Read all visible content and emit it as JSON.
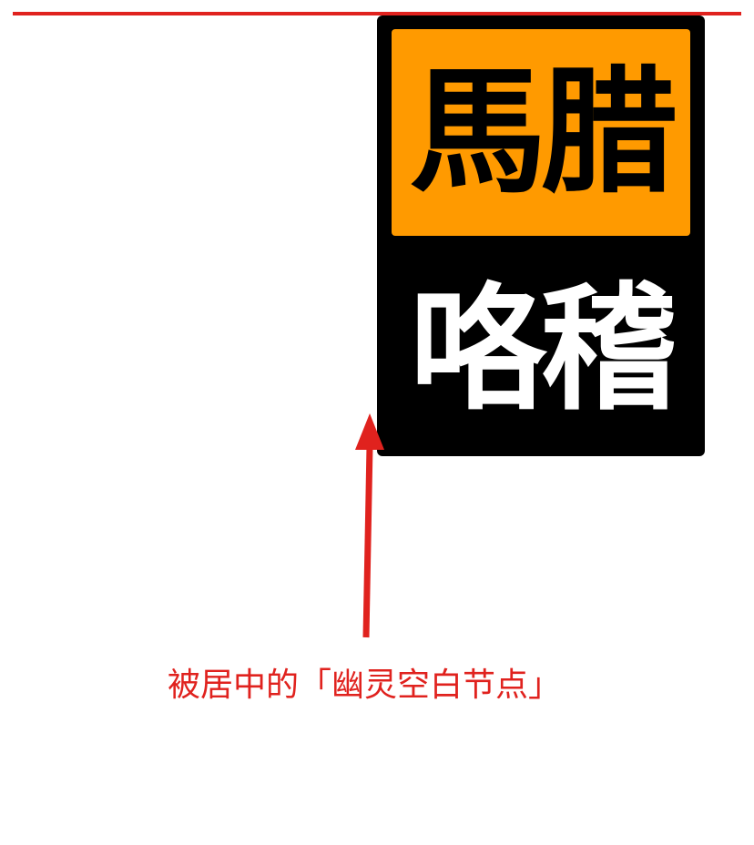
{
  "colors": {
    "accent_red": "#e0221e",
    "card_orange": "#ff9a00",
    "card_black": "#000000",
    "background": "#ffffff"
  },
  "card": {
    "top_text": "馬腊",
    "bottom_text": "咯稽"
  },
  "annotation": {
    "caption": "被居中的「幽灵空白节点」",
    "arrow_icon": "up-arrow-icon"
  }
}
